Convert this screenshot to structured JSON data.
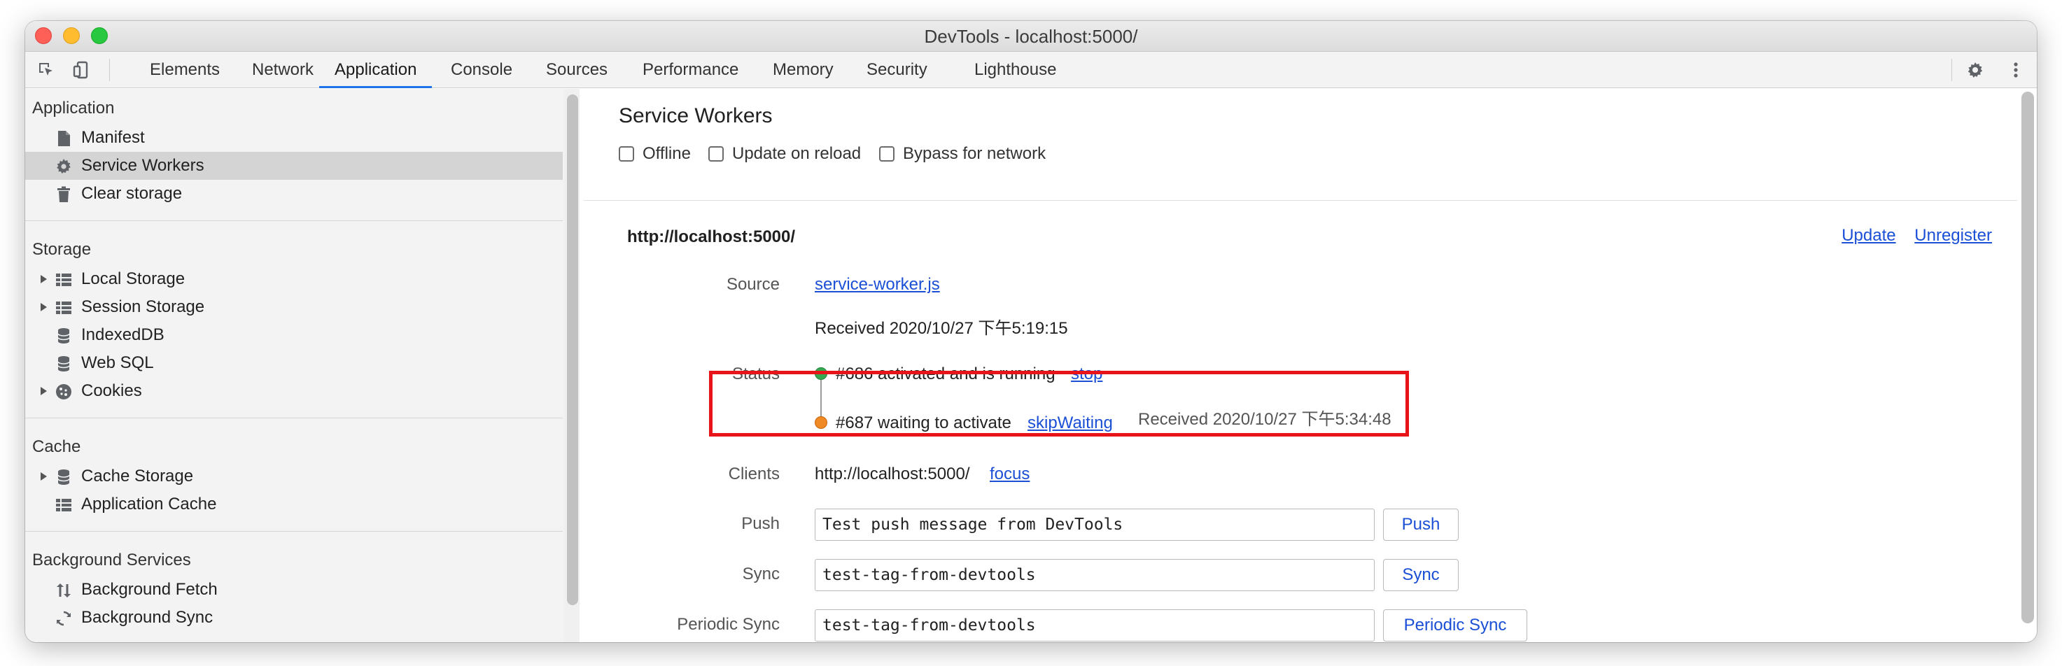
{
  "window": {
    "title": "DevTools - localhost:5000/"
  },
  "toolbar": {
    "inspect_icon": "inspect-element-icon",
    "device_icon": "device-toolbar-icon",
    "tabs": [
      {
        "label": "Elements"
      },
      {
        "label": "Network"
      },
      {
        "label": "Application"
      },
      {
        "label": "Console"
      },
      {
        "label": "Sources"
      },
      {
        "label": "Performance"
      },
      {
        "label": "Memory"
      },
      {
        "label": "Security"
      },
      {
        "label": "Lighthouse"
      }
    ],
    "active_tab": "Application",
    "settings_icon": "gear-icon",
    "more_icon": "kebab-menu-icon"
  },
  "sidebar": {
    "application": {
      "heading": "Application",
      "items": [
        {
          "label": "Manifest",
          "icon": "document-icon"
        },
        {
          "label": "Service Workers",
          "icon": "gear-icon",
          "selected": true
        },
        {
          "label": "Clear storage",
          "icon": "trash-icon"
        }
      ]
    },
    "storage": {
      "heading": "Storage",
      "items": [
        {
          "label": "Local Storage",
          "icon": "grid-icon",
          "expandable": true
        },
        {
          "label": "Session Storage",
          "icon": "grid-icon",
          "expandable": true
        },
        {
          "label": "IndexedDB",
          "icon": "database-icon"
        },
        {
          "label": "Web SQL",
          "icon": "database-icon"
        },
        {
          "label": "Cookies",
          "icon": "cookie-icon",
          "expandable": true
        }
      ]
    },
    "cache": {
      "heading": "Cache",
      "items": [
        {
          "label": "Cache Storage",
          "icon": "database-icon",
          "expandable": true
        },
        {
          "label": "Application Cache",
          "icon": "grid-icon"
        }
      ]
    },
    "background": {
      "heading": "Background Services",
      "items": [
        {
          "label": "Background Fetch",
          "icon": "up-down-arrows-icon"
        },
        {
          "label": "Background Sync",
          "icon": "sync-icon"
        }
      ]
    }
  },
  "main": {
    "title": "Service Workers",
    "options": [
      {
        "label": "Offline",
        "checked": false
      },
      {
        "label": "Update on reload",
        "checked": false
      },
      {
        "label": "Bypass for network",
        "checked": false
      }
    ],
    "origin": "http://localhost:5000/",
    "update_link": "Update",
    "unregister_link": "Unregister",
    "source": {
      "label": "Source",
      "file": "service-worker.js",
      "received": "Received 2020/10/27 下午5:19:15"
    },
    "status": {
      "label": "Status",
      "active": {
        "text": "#686 activated and is running",
        "action": "stop",
        "color": "#36a852"
      },
      "waiting": {
        "text": "#687 waiting to activate",
        "action": "skipWaiting",
        "received": "Received 2020/10/27 下午5:34:48",
        "color": "#f08a24"
      }
    },
    "clients": {
      "label": "Clients",
      "value": "http://localhost:5000/",
      "action": "focus"
    },
    "push": {
      "label": "Push",
      "value": "Test push message from DevTools",
      "button": "Push"
    },
    "sync": {
      "label": "Sync",
      "value": "test-tag-from-devtools",
      "button": "Sync"
    },
    "periodic_sync": {
      "label": "Periodic Sync",
      "value": "test-tag-from-devtools",
      "button": "Periodic Sync"
    },
    "highlight_color": "#e8141a"
  }
}
